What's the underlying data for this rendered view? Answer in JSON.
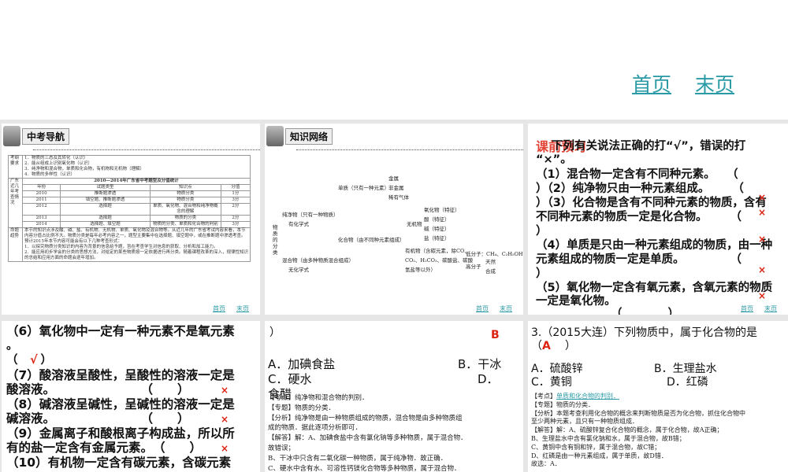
{
  "top": {
    "nav": [
      "首页",
      "末页"
    ]
  },
  "nav": [
    "首页",
    "末页"
  ],
  "slide1": {
    "header": "中考导航",
    "row1_label": "考纲要求",
    "row1_items": [
      "1．物质的三态及其转化（认识）",
      "2．能从组成上识别氧化物（认识）",
      "3．纯净物和混合物，单质和化合物，有机物和无机物（理解）",
      "4．物质的多样性（认识）"
    ],
    "row2_label": "广东近几年考查情况",
    "table_title": "2010—2014年广东省中考题型及分值统计",
    "table_headers": [
      "年份",
      "试题类型",
      "知识点",
      "分值"
    ],
    "table_rows": [
      [
        "2010",
        "推断题渗透",
        "物质分类",
        "1分"
      ],
      [
        "2011",
        "填空题、推断题渗透",
        "物质分类",
        "3分"
      ],
      [
        "2012",
        "选择题",
        "单质、氧化物、混合物和纯净物概念的理解",
        "2分"
      ],
      [
        "2013",
        "选择题",
        "物质的分类",
        "2分"
      ],
      [
        "2014",
        "选择题、填空题",
        "物质的分类、单质和化合物的判别",
        "3分"
      ]
    ],
    "row3_label": "命题趋势",
    "row3_text": [
      "本节的知识点涉及酸、碱、盐、有机物、无机物、单质、氧化物及混合物等。从近几年的广东省考试内容来看，本节内容分值占比例不大。物质分类是每年必考内容之一，题型主要集中在选择题、填空题中，或在推断题中渗透考查。",
      "预计2015年本节内容可能会有以下几种考查形式：",
      "1．以探究物质分类知识的内容为背景的信息给予题，旨在考查学生对信息的获取、分析和加工能力。",
      "2．能应用初步学会的分类的思想方法，对给定的某些物质按一定依据进行再分类。随着课程改革的深入，规律性知识的总结和应用方面的命题会逐年增加。"
    ]
  },
  "slide2": {
    "header": "知识网络",
    "root": "物质的分类",
    "pure": "纯净物（只有一种物质）",
    "pure_sub": "有化学式",
    "mix": "混合物（由多种物质混合组成）",
    "mix_sub": "无化学式",
    "element": "单质（只有一种元素）",
    "element_kids": [
      "金属",
      "非金属",
      "稀有气体"
    ],
    "compound": "化合物（由不同种元素组成）",
    "inorganic": "无机物",
    "inorganic_kids": [
      "氧化物（特征）",
      "酸（特征）",
      "碱（特征）",
      "盐（特征）"
    ],
    "organic": [
      "有机物（含碳元素，除CO、",
      "CO₂、H₂CO₃、碳酸盐、碳酸",
      "氢盐等以外）"
    ],
    "small": "低分子：CH₄、C₂H₅OH 等",
    "large": "高分子",
    "large_kids": [
      "天然",
      "合成"
    ]
  },
  "slide3": {
    "title": "课前预习",
    "lines": [
      "下列有关说法正确的打“√”，错误的打",
      "“×”。",
      "（1）混合物一定含有不同种元素。　　（",
      "）（2）纯净物只由一种元素组成。　　　（",
      "）（3）化合物是含有不同种元素的物质，含有",
      "不同种元素的物质一定是化合物。　　　（",
      "）",
      "（4）单质是只由一种元素组成的物质，由一种",
      "元素组成的物质一定是单质。　　　　　（",
      "）",
      "（5）氧化物一定含有氧元素，含氧元素的物质",
      "一定是氧化物。",
      "（　　　　）"
    ],
    "mark": "×"
  },
  "slide4": {
    "lines": [
      "（6）氧化物中一定有一种元素不是氧元素",
      "。",
      "（　　）",
      "（7）酸溶液呈酸性，呈酸性的溶液一定是",
      "酸溶液。　　　　　　　　（　　）",
      "（8）碱溶液呈碱性，呈碱性的溶液一定是",
      "碱溶液。　　　　　　　　（　　）",
      "（9）金属离子和酸根离子构成盐，所以所",
      "有的盐一定含有金属元素。　（　　）",
      "（10）有机物一定含有碳元素，含碳元素"
    ],
    "answers": [
      "√",
      "×",
      "×",
      "×"
    ]
  },
  "slide5": {
    "paren": "）",
    "answer": "B",
    "options": [
      "A．加碘食盐",
      "B．干冰",
      "C．硬水",
      "D．",
      "食醋"
    ],
    "analysis": [
      "【考点】纯净物和混合物的判别．",
      "【专题】物质的分类．",
      "【分析】纯净物是由一种物质组成的物质，混合物是由多种物质组",
      "成的物质．据此逐项分析即可．",
      "【解答】解：A、加碘食盐中含有氯化钠等多种物质，属于混合物．",
      "故错误；",
      "B、干冰中只含有二氧化碳一种物质，属于纯净物．故正确．",
      "C、硬水中含有水、可溶性钙镁化合物等多种物质，属于混合物．"
    ]
  },
  "slide6": {
    "question": "3.（2015大连）下列物质中，属于化合物的是",
    "paren_open": "（",
    "answer": "A",
    "paren_close": "）",
    "options": [
      "A．硫酸锌",
      "B．生理盐水",
      "C．黄铜",
      "D．红磷"
    ],
    "kaodian_label": "【考点】",
    "kaodian_link": "单质和化合物的判别．",
    "analysis": [
      "【专题】物质的分类．",
      "【分析】本题考查利用化合物的概念来判断物质是否为化合物，抓住化合物中",
      "至少两种元素，且只有一种物质组成．",
      "【解答】解：A、硫酸锌复合化合物的概念，属于化合物，故A正确；",
      "B、生理盐水中含有氯化钠和水，属于混合物，故B错；",
      "C、黄铜中含有铜和锌，属于混合物，故C错；",
      "D、红磷是由一种元素组成，属于单质，故D错．",
      "故选：A．"
    ]
  },
  "colors": {
    "link": "#2a9aa6",
    "red": "#d21"
  }
}
